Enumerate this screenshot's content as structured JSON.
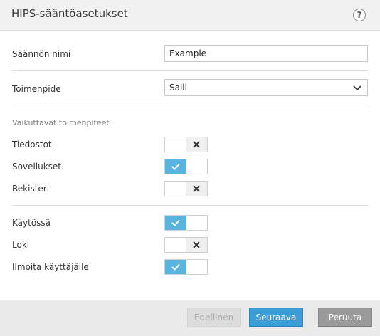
{
  "window": {
    "title": "HIPS-sääntöasetukset",
    "help_icon_glyph": "?",
    "help_icon": "help-circle-icon"
  },
  "form": {
    "rule_name_label": "Säännön nimi",
    "rule_name_value": "Example",
    "action_label": "Toimenpide",
    "action_value": "Salli",
    "affected_section_label": "Vaikuttavat toimenpiteet",
    "toggles": [
      {
        "label": "Tiedostot",
        "checked": false
      },
      {
        "label": "Sovellukset",
        "checked": true
      },
      {
        "label": "Rekisteri",
        "checked": false
      },
      {
        "label": "Käytössä",
        "checked": true
      },
      {
        "label": "Loki",
        "checked": false
      },
      {
        "label": "Ilmoita käyttäjälle",
        "checked": true
      }
    ]
  },
  "footer": {
    "back_label": "Edellinen",
    "next_label": "Seuraava",
    "cancel_label": "Peruuta"
  },
  "colors": {
    "toggle_on": "#5ab4e0",
    "primary_button": "#3b9ed8",
    "cancel_button": "#9a9a9a",
    "disabled_button": "#dcdcdc"
  }
}
